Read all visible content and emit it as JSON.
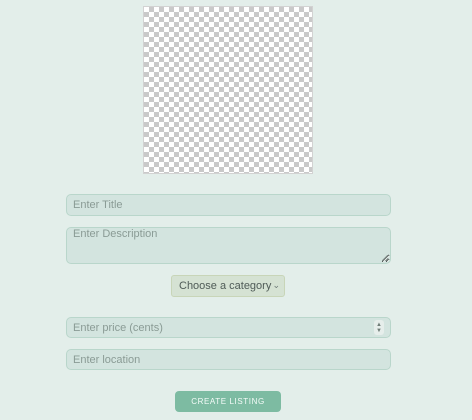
{
  "image_preview": {
    "icon": "transparent-image-placeholder-icon"
  },
  "form": {
    "title_placeholder": "Enter Title",
    "description_placeholder": "Enter Description",
    "category_selected": "Choose a category",
    "price_placeholder": "Enter price (cents)",
    "location_placeholder": "Enter location",
    "submit_label": "CREATE LISTING"
  },
  "colors": {
    "background": "#e3eeea",
    "field_background": "#d3e4df",
    "button": "#7dbba2"
  }
}
